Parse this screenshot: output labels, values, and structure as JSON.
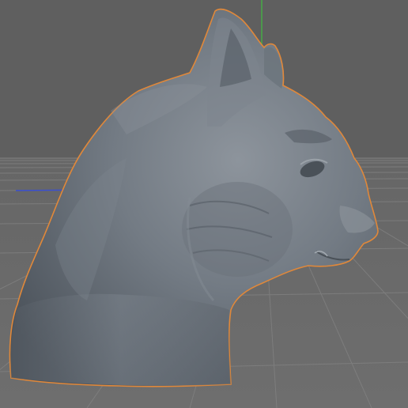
{
  "viewport": {
    "mode": "perspective",
    "background_color": "#5f5f5f",
    "floor_color": "#6b6b6b",
    "grid_color": "#7d7d7d",
    "grid_visible": true,
    "y_axis_color": "#3fbf3f",
    "x_axis_color": "#3a4fd0"
  },
  "scene_object": {
    "name_icon": "cat-head-sculpt-icon",
    "material_color": "#6f7780",
    "selected": true,
    "selection_outline_color": "#e0883a"
  }
}
